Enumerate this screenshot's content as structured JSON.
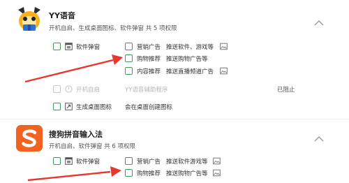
{
  "apps": [
    {
      "name": "YY语音",
      "summary": "开机自启、生成桌面图标、软件弹窗 共 5 项权限",
      "icon": "yy-bear-logo-icon",
      "permissions": {
        "popup_label": "软件弹窗",
        "marketing_label": "营销广告",
        "marketing_desc": "推送软件、游戏等",
        "shopping_label": "购物推荐",
        "shopping_desc": "推送购物广告等",
        "content_label": "内容推荐",
        "content_desc": "推送直播频道广告",
        "autostart_label": "开机自启",
        "autostart_desc": "YY语音辅助程序",
        "autostart_status": "已阻止",
        "desktop_label": "生成桌面图标",
        "desktop_desc": "会在桌面创建图标"
      }
    },
    {
      "name": "搜狗拼音输入法",
      "summary": "开机自启、软件弹窗 共 6 项权限",
      "icon": "sogou-s-logo-icon",
      "permissions": {
        "popup_label": "软件弹窗",
        "marketing_label": "营销广告",
        "marketing_desc": "推送软件游戏等",
        "shopping_label": "购物推荐",
        "shopping_desc": "推送购物广告等"
      }
    }
  ],
  "colors": {
    "accent_green": "#3f9b57",
    "arrow_red": "#e8372c",
    "disabled_gray": "#b5b5b5"
  }
}
